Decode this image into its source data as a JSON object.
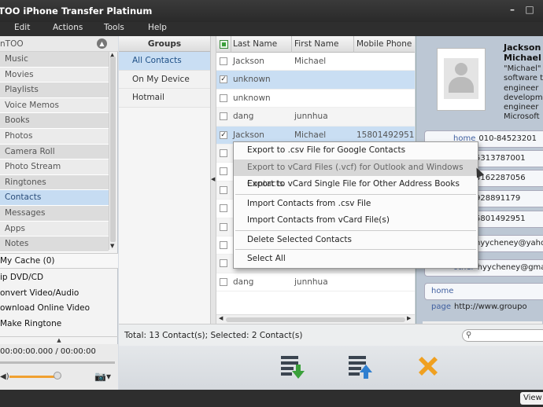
{
  "window": {
    "title": "TOO iPhone Transfer Platinum"
  },
  "menu": [
    "Edit",
    "Actions",
    "Tools",
    "Help"
  ],
  "device": {
    "name": "nTOO"
  },
  "nav": [
    {
      "label": "Music"
    },
    {
      "label": "Movies"
    },
    {
      "label": "Playlists"
    },
    {
      "label": "Voice Memos"
    },
    {
      "label": "Books"
    },
    {
      "label": "Photos"
    },
    {
      "label": "Camera Roll"
    },
    {
      "label": "Photo Stream"
    },
    {
      "label": "Ringtones"
    },
    {
      "label": "Contacts",
      "active": true
    },
    {
      "label": "Messages"
    },
    {
      "label": "Apps"
    },
    {
      "label": "Notes"
    }
  ],
  "cache": {
    "label": "My Cache (0)"
  },
  "tools": [
    "ip DVD/CD",
    "onvert Video/Audio",
    "ownload Online Video",
    "Make Ringtone"
  ],
  "player": {
    "time": "00:00:00.000 / 00:00:00"
  },
  "groups": {
    "header": "Groups",
    "items": [
      {
        "label": "All Contacts",
        "active": true
      },
      {
        "label": "On My Device"
      },
      {
        "label": "Hotmail"
      }
    ]
  },
  "table": {
    "columns": [
      "Last Name",
      "First Name",
      "Mobile Phone"
    ],
    "rows": [
      {
        "last": "Jackson",
        "first": "Michael",
        "phone": "",
        "checked": false,
        "sel": false
      },
      {
        "last": "unknown",
        "first": "",
        "phone": "",
        "checked": true,
        "sel": true
      },
      {
        "last": "unknown",
        "first": "",
        "phone": "",
        "checked": false,
        "sel": false
      },
      {
        "last": "dang",
        "first": "junnhua",
        "phone": "",
        "checked": false,
        "sel": false
      },
      {
        "last": "Jackson",
        "first": "Michael",
        "phone": "15801492951",
        "checked": true,
        "sel": true
      },
      {
        "last": "",
        "first": "",
        "phone": "",
        "checked": false,
        "sel": false
      },
      {
        "last": "",
        "first": "",
        "phone": "",
        "checked": false,
        "sel": false
      },
      {
        "last": "",
        "first": "",
        "phone": "",
        "checked": false,
        "sel": false
      },
      {
        "last": "",
        "first": "",
        "phone": "",
        "checked": false,
        "sel": false
      },
      {
        "last": "",
        "first": "",
        "phone": "",
        "checked": false,
        "sel": false
      },
      {
        "last": "",
        "first": "",
        "phone": "",
        "checked": false,
        "sel": false
      },
      {
        "last": "",
        "first": "",
        "phone": "",
        "checked": false,
        "sel": false
      },
      {
        "last": "dang",
        "first": "junnhua",
        "phone": "",
        "checked": false,
        "sel": false
      }
    ]
  },
  "context_menu": [
    {
      "label": "Export to .csv File for Google Contacts"
    },
    {
      "label": "Export to vCard Files (.vcf) for Outlook and Windows Contacts",
      "hover": true
    },
    {
      "label": "Export to vCard Single File for Other Address Books"
    },
    {
      "sep": true
    },
    {
      "label": "Import Contacts from .csv File"
    },
    {
      "label": "Import Contacts from vCard File(s)"
    },
    {
      "sep": true
    },
    {
      "label": "Delete Selected Contacts"
    },
    {
      "sep": true
    },
    {
      "label": "Select All"
    }
  ],
  "detail": {
    "name_line1": "Jackson",
    "name_line2": "Michael",
    "note": "\"Michael\"\nsoftware te\nengineer  -\ndevelopme\nengineer\nMicrosoft",
    "fields": [
      {
        "label": "home",
        "value": "010-84523201"
      },
      {
        "label": "",
        "value": "5313787001"
      },
      {
        "label": "",
        "value": "4162287056"
      },
      {
        "label": "",
        "value": "928891179"
      },
      {
        "label": "",
        "value": "5801492951"
      },
      {
        "label": "",
        "value": "hyycheney@yahoo."
      },
      {
        "label": "other",
        "value": "hyycheney@gmail.com"
      },
      {
        "label": "home page",
        "value": "http://www.groupo"
      }
    ]
  },
  "status": {
    "text": "Total: 13 Contact(s); Selected: 2 Contact(s)"
  },
  "bottom": {
    "view_label": "View"
  },
  "colors": {
    "accent": "#c9def3",
    "add_icon": "#3aa03a",
    "export_icon": "#2f7fd0",
    "delete_icon": "#f0a020"
  }
}
